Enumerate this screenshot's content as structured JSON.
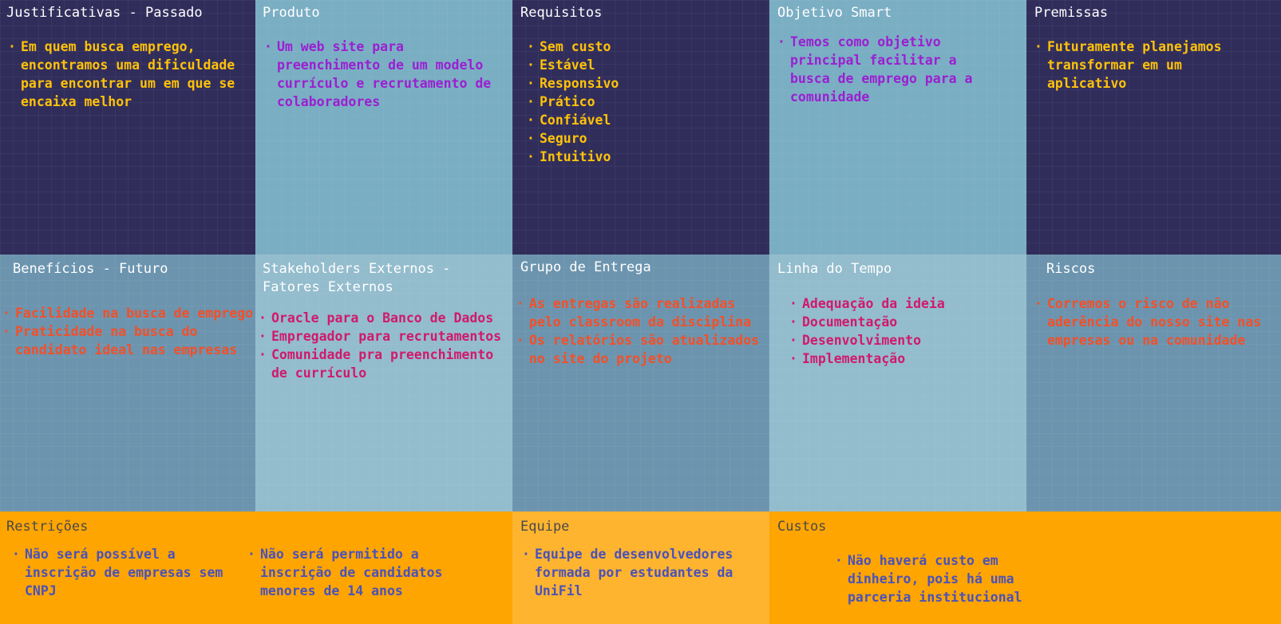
{
  "cells": {
    "justificativas": {
      "title": "Justificativas - Passado",
      "items": [
        "Em quem busca emprego, encontramos uma dificuldade para encontrar um em que se encaixa melhor"
      ]
    },
    "produto": {
      "title": "Produto",
      "items": [
        "Um web site para preenchimento de um modelo currículo e recrutamento de colaboradores"
      ]
    },
    "requisitos": {
      "title": "Requisitos",
      "items": [
        "Sem custo",
        "Estável",
        "Responsivo",
        "Prático",
        "Confiável",
        "Seguro",
        "Intuitivo"
      ]
    },
    "objetivo": {
      "title": "Objetivo Smart",
      "items": [
        "Temos como objetivo principal facilitar a busca de emprego para a comunidade"
      ]
    },
    "premissas": {
      "title": "Premissas",
      "items": [
        "Futuramente planejamos transformar em um aplicativo"
      ]
    },
    "beneficios": {
      "title": "Benefícios - Futuro",
      "items": [
        "Facilidade na busca de emprego",
        "Praticidade na busca do candidato ideal nas empresas"
      ]
    },
    "stakeholders": {
      "title": "Stakeholders Externos -\nFatores Externos",
      "items": [
        "Oracle para o Banco de Dados",
        "Empregador para recrutamentos",
        "Comunidade pra preenchimento de currículo"
      ]
    },
    "grupo": {
      "title": "Grupo de Entrega",
      "items": [
        "As entregas são realizadas pelo classroom da disciplina",
        "Os relatórios são atualizados no site do projeto"
      ]
    },
    "linha": {
      "title": "Linha do Tempo",
      "items": [
        "Adequação da ideia",
        "Documentação",
        "Desenvolvimento",
        "Implementação"
      ]
    },
    "riscos": {
      "title": "Riscos",
      "items": [
        "Corremos o risco de não aderência do nosso site nas empresas ou na comunidade"
      ]
    },
    "restricoes": {
      "title": "Restrições",
      "items_a": [
        "Não será possível a inscrição de empresas sem CNPJ"
      ],
      "items_b": [
        "Não será permitido a inscrição de candidatos menores de 14 anos"
      ]
    },
    "equipe": {
      "title": "Equipe",
      "items": [
        "Equipe de desenvolvedores formada por estudantes da UniFil"
      ]
    },
    "custos": {
      "title": "Custos",
      "items": [
        "Não haverá custo em dinheiro, pois há uma parceria institucional"
      ]
    }
  },
  "colors": {
    "navy": "#312d5b",
    "light_blue": "#7aaec3",
    "mid_blue": "#6c94ae",
    "pale_blue": "#93bccd",
    "orange": "#fea502",
    "light_orange": "#feb42f",
    "yellow_text": "#fec20a",
    "purple_text": "#9b1fd1",
    "red_text": "#f2502a",
    "pink_text": "#d01a6c",
    "blue_text": "#4b52b8"
  }
}
